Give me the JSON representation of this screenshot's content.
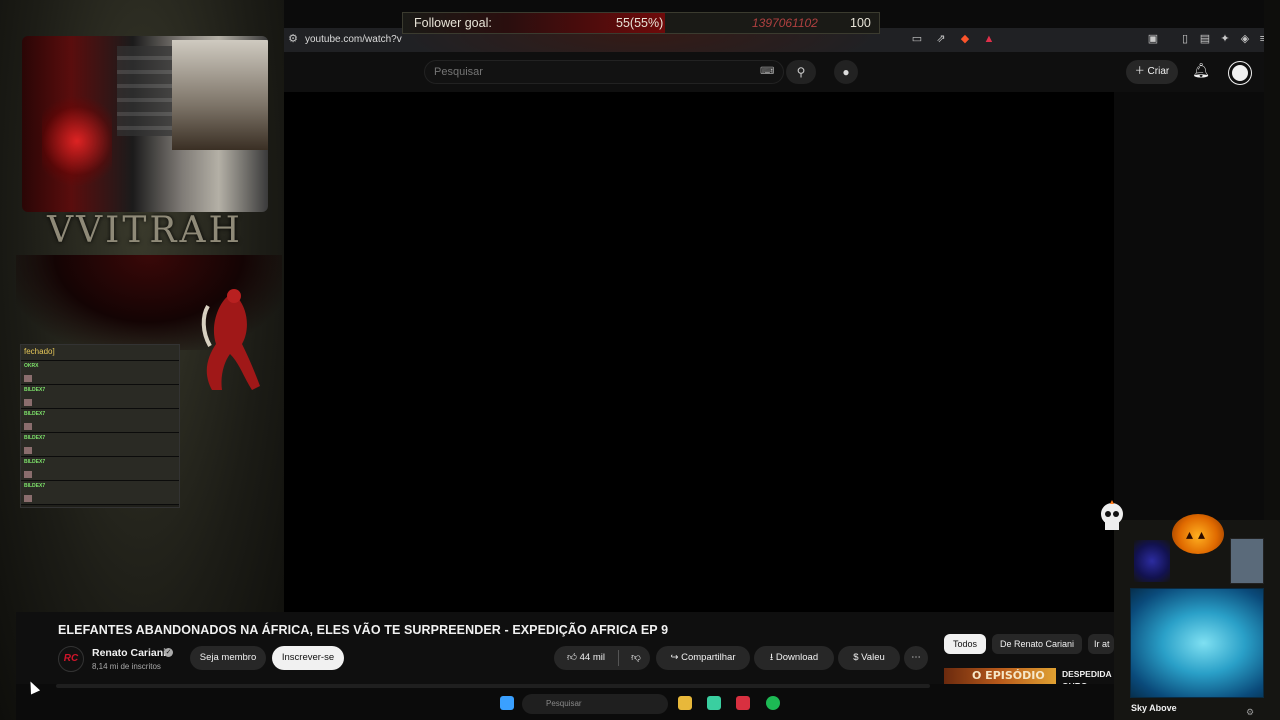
{
  "overlay": {
    "streamer_name": "VVITRAH",
    "goal": {
      "label": "Follower goal:",
      "count": "55(55%)",
      "mid_text": "1397061102",
      "target": "100",
      "progress_fraction": 0.55
    },
    "chat": {
      "first_line": "fechado]",
      "lines": [
        {
          "user": "OKRX"
        },
        {
          "user": "BILDEX7"
        },
        {
          "user": "BILDEX7"
        },
        {
          "user": "BILDEX7"
        },
        {
          "user": "BILDEX7"
        },
        {
          "user": "BILDEX7"
        }
      ]
    }
  },
  "browser": {
    "url": "youtube.com/watch?v"
  },
  "header": {
    "search_placeholder": "Pesquisar",
    "create_label": "Criar"
  },
  "video": {
    "title": "ELEFANTES ABANDONADOS NA ÁFRICA, ELES VÃO TE SURPREENDER - EXPEDIÇÃO AFRICA EP 9",
    "channel_name": "Renato Cariani",
    "subscribers": "8,14 mi de inscritos",
    "join_label": "Seja membro",
    "subscribe_label": "Inscrever-se",
    "likes": "44 mil",
    "share_label": "Compartilhar",
    "download_label": "Download",
    "thanks_label": "Valeu",
    "more_label": "⋯"
  },
  "chips": {
    "all": "Todos",
    "channel": "De Renato Cariani",
    "more": "Ir at"
  },
  "recommendation": {
    "thumb_text": "O EPISÓDIO",
    "title": "DESPEDIDA OURO RICHA"
  },
  "taskbar": {
    "search_placeholder": "Pesquisar"
  },
  "music": {
    "title": "Sky Above"
  },
  "colors": {
    "accent_red": "#d0142a",
    "goal_red": "#6e0a0a",
    "pumpkin": "#e06a00"
  }
}
